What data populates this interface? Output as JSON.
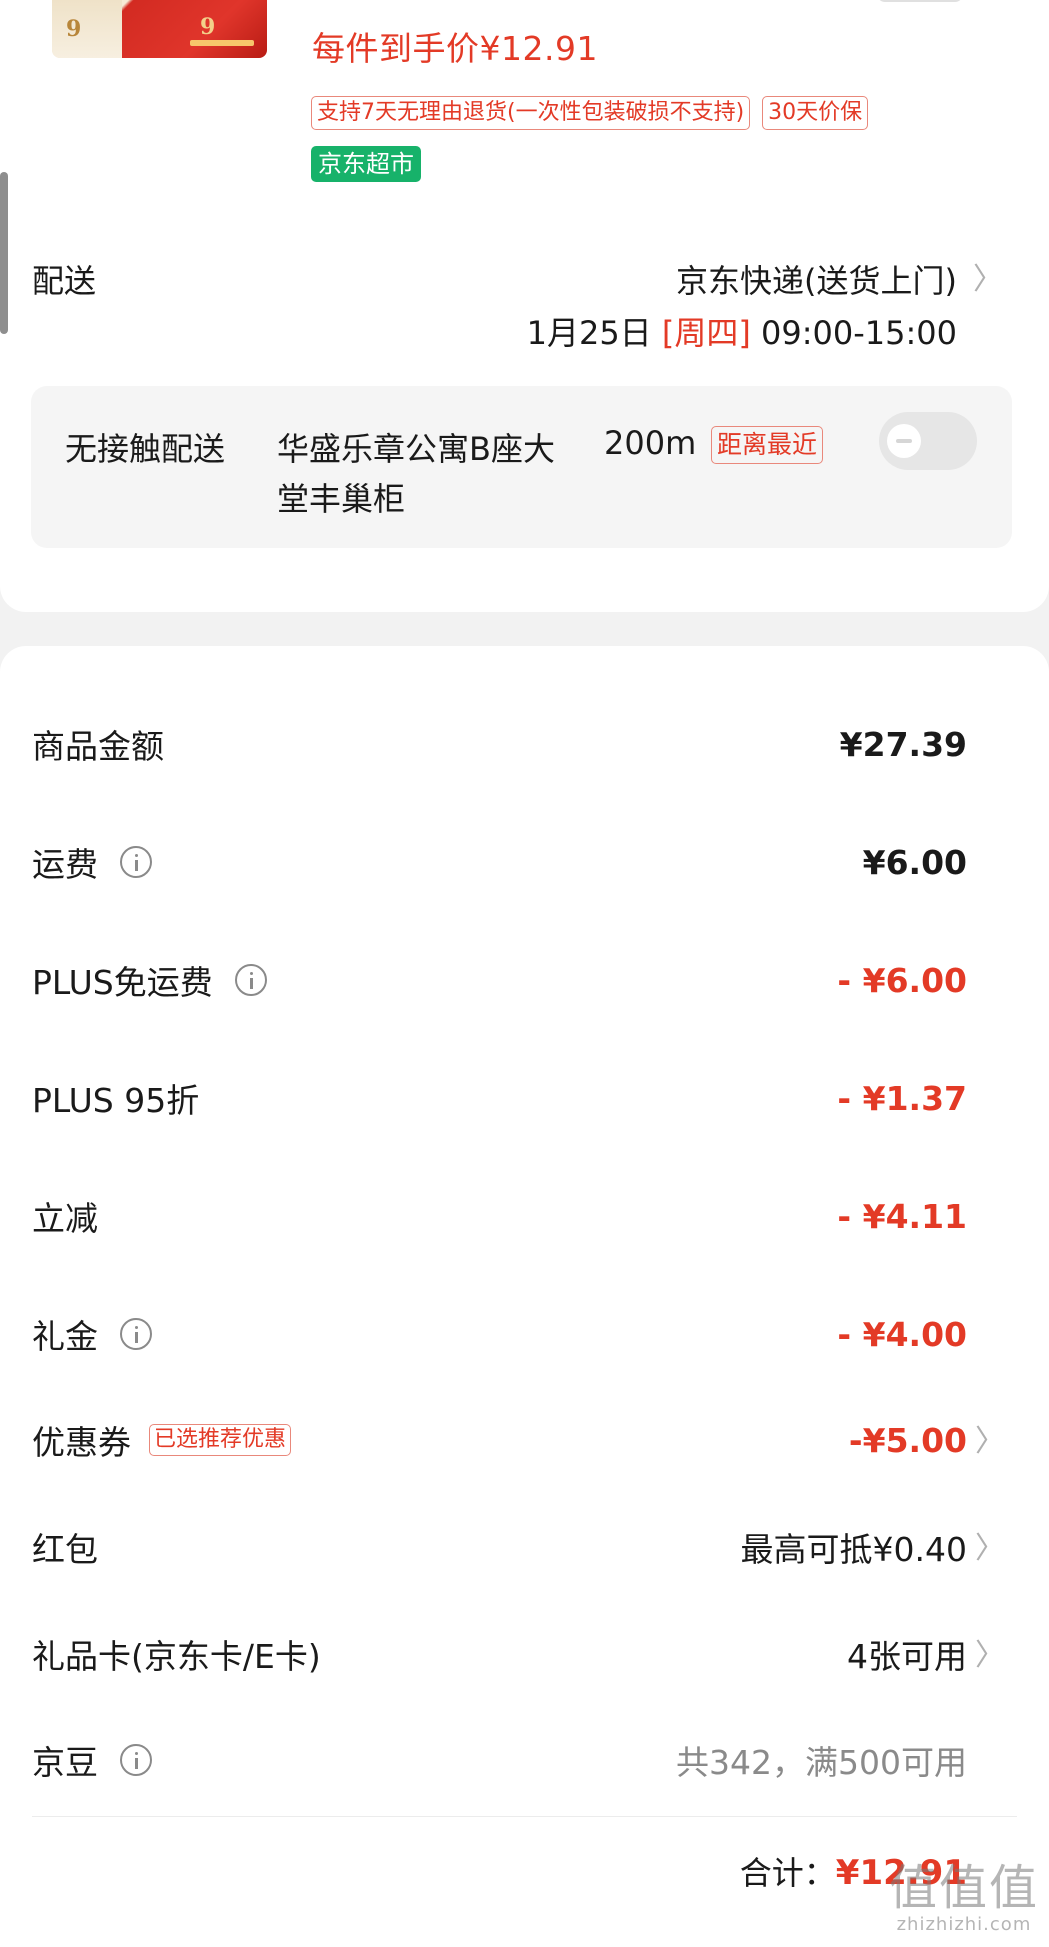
{
  "product": {
    "price_line": "每件到手价¥12.91",
    "tags": [
      "支持7天无理由退货(一次性包装破损不支持)",
      "30天价保"
    ],
    "store_tag": "京东超市"
  },
  "delivery": {
    "label": "配送",
    "method": "京东快递(送货上门)",
    "date": "1月25日",
    "weekday": "[周四]",
    "time": "09:00-15:00"
  },
  "contactless": {
    "label": "无接触配送",
    "place": "华盛乐章公寓B座大堂丰巢柜",
    "distance": "200m",
    "tag": "距离最近",
    "toggle_on": false
  },
  "summary": {
    "rows": [
      {
        "label": "商品金额",
        "value": "¥27.39"
      },
      {
        "label": "运费",
        "value": "¥6.00"
      },
      {
        "label": "PLUS免运费",
        "value": "- ¥6.00"
      },
      {
        "label": "PLUS 95折",
        "value": "- ¥1.37"
      },
      {
        "label": "立减",
        "value": "- ¥4.11"
      },
      {
        "label": "礼金",
        "value": "- ¥4.00"
      },
      {
        "label": "优惠券",
        "tag": "已选推荐优惠",
        "value": "-¥5.00"
      },
      {
        "label": "红包",
        "value": "最高可抵¥0.40"
      },
      {
        "label": "礼品卡(京东卡/E卡)",
        "value": "4张可用"
      },
      {
        "label": "京豆",
        "value": "共342，满500可用"
      }
    ],
    "total_label": "合计：",
    "total_value": "¥12.91"
  },
  "watermark": {
    "big": "值值值",
    "small": "zhizhizhi.com"
  },
  "colors": {
    "accent_red": "#e33a26",
    "green": "#17b26a"
  }
}
